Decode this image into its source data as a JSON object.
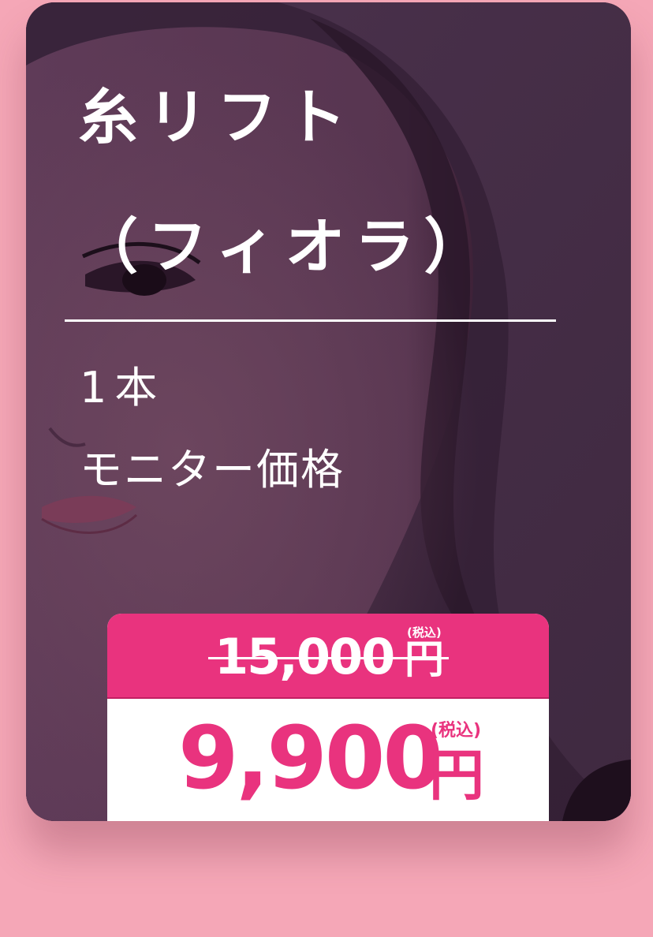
{
  "card": {
    "title_line_1": "糸リフト",
    "title_line_2": "（フィオラ）",
    "count": "1本",
    "monitor_label": "モニター価格"
  },
  "price": {
    "original_amount": "15,000",
    "original_yen": "円",
    "original_tax_label": "(税込)",
    "sale_amount": "9,900",
    "sale_yen": "円",
    "sale_tax_label": "(税込)"
  },
  "colors": {
    "page_background": "#f5a7b7",
    "card_overlay": "#47304a",
    "price_accent": "#e9337e",
    "text_on_dark": "#ffffff"
  },
  "images": {
    "card_background": "portrait-photo"
  }
}
